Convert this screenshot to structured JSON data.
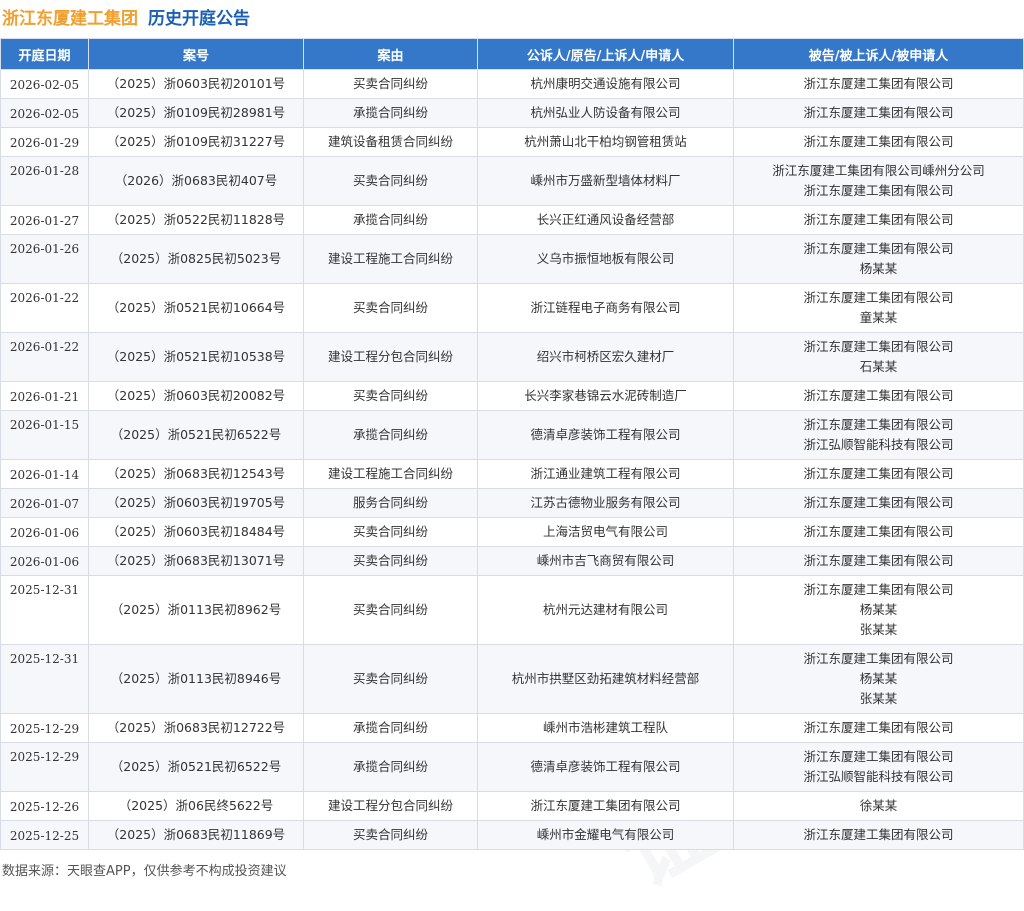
{
  "header": {
    "company": "浙江东厦建工集团",
    "title": "历史开庭公告"
  },
  "table": {
    "columns": [
      "开庭日期",
      "案号",
      "案由",
      "公诉人/原告/上诉人/申请人",
      "被告/被上诉人/被申请人"
    ],
    "rows": [
      {
        "date": "2026-02-05",
        "case": "（2025）浙0603民初20101号",
        "cause": "买卖合同纠纷",
        "plaintiff": "杭州康明交通设施有限公司",
        "defendants": [
          "浙江东厦建工集团有限公司"
        ]
      },
      {
        "date": "2026-02-05",
        "case": "（2025）浙0109民初28981号",
        "cause": "承揽合同纠纷",
        "plaintiff": "杭州弘业人防设备有限公司",
        "defendants": [
          "浙江东厦建工集团有限公司"
        ]
      },
      {
        "date": "2026-01-29",
        "case": "（2025）浙0109民初31227号",
        "cause": "建筑设备租赁合同纠纷",
        "plaintiff": "杭州萧山北干柏均钢管租赁站",
        "defendants": [
          "浙江东厦建工集团有限公司"
        ]
      },
      {
        "date": "2026-01-28",
        "case": "（2026）浙0683民初407号",
        "cause": "买卖合同纠纷",
        "plaintiff": "嵊州市万盛新型墙体材料厂",
        "defendants": [
          "浙江东厦建工集团有限公司嵊州分公司",
          "浙江东厦建工集团有限公司"
        ]
      },
      {
        "date": "2026-01-27",
        "case": "（2025）浙0522民初11828号",
        "cause": "承揽合同纠纷",
        "plaintiff": "长兴正红通风设备经营部",
        "defendants": [
          "浙江东厦建工集团有限公司"
        ]
      },
      {
        "date": "2026-01-26",
        "case": "（2025）浙0825民初5023号",
        "cause": "建设工程施工合同纠纷",
        "plaintiff": "义乌市振恒地板有限公司",
        "defendants": [
          "浙江东厦建工集团有限公司",
          "杨某某"
        ]
      },
      {
        "date": "2026-01-22",
        "case": "（2025）浙0521民初10664号",
        "cause": "买卖合同纠纷",
        "plaintiff": "浙江链程电子商务有限公司",
        "defendants": [
          "浙江东厦建工集团有限公司",
          "童某某"
        ]
      },
      {
        "date": "2026-01-22",
        "case": "（2025）浙0521民初10538号",
        "cause": "建设工程分包合同纠纷",
        "plaintiff": "绍兴市柯桥区宏久建材厂",
        "defendants": [
          "浙江东厦建工集团有限公司",
          "石某某"
        ]
      },
      {
        "date": "2026-01-21",
        "case": "（2025）浙0603民初20082号",
        "cause": "买卖合同纠纷",
        "plaintiff": "长兴李家巷锦云水泥砖制造厂",
        "defendants": [
          "浙江东厦建工集团有限公司"
        ]
      },
      {
        "date": "2026-01-15",
        "case": "（2025）浙0521民初6522号",
        "cause": "承揽合同纠纷",
        "plaintiff": "德清卓彦装饰工程有限公司",
        "defendants": [
          "浙江东厦建工集团有限公司",
          "浙江弘顺智能科技有限公司"
        ]
      },
      {
        "date": "2026-01-14",
        "case": "（2025）浙0683民初12543号",
        "cause": "建设工程施工合同纠纷",
        "plaintiff": "浙江通业建筑工程有限公司",
        "defendants": [
          "浙江东厦建工集团有限公司"
        ]
      },
      {
        "date": "2026-01-07",
        "case": "（2025）浙0603民初19705号",
        "cause": "服务合同纠纷",
        "plaintiff": "江苏古德物业服务有限公司",
        "defendants": [
          "浙江东厦建工集团有限公司"
        ]
      },
      {
        "date": "2026-01-06",
        "case": "（2025）浙0603民初18484号",
        "cause": "买卖合同纠纷",
        "plaintiff": "上海洁贸电气有限公司",
        "defendants": [
          "浙江东厦建工集团有限公司"
        ]
      },
      {
        "date": "2026-01-06",
        "case": "（2025）浙0683民初13071号",
        "cause": "买卖合同纠纷",
        "plaintiff": "嵊州市吉飞商贸有限公司",
        "defendants": [
          "浙江东厦建工集团有限公司"
        ]
      },
      {
        "date": "2025-12-31",
        "case": "（2025）浙0113民初8962号",
        "cause": "买卖合同纠纷",
        "plaintiff": "杭州元达建材有限公司",
        "defendants": [
          "浙江东厦建工集团有限公司",
          "杨某某",
          "张某某"
        ]
      },
      {
        "date": "2025-12-31",
        "case": "（2025）浙0113民初8946号",
        "cause": "买卖合同纠纷",
        "plaintiff": "杭州市拱墅区劲拓建筑材料经营部",
        "defendants": [
          "浙江东厦建工集团有限公司",
          "杨某某",
          "张某某"
        ]
      },
      {
        "date": "2025-12-29",
        "case": "（2025）浙0683民初12722号",
        "cause": "承揽合同纠纷",
        "plaintiff": "嵊州市浩彬建筑工程队",
        "defendants": [
          "浙江东厦建工集团有限公司"
        ]
      },
      {
        "date": "2025-12-29",
        "case": "（2025）浙0521民初6522号",
        "cause": "承揽合同纠纷",
        "plaintiff": "德清卓彦装饰工程有限公司",
        "defendants": [
          "浙江东厦建工集团有限公司",
          "浙江弘顺智能科技有限公司"
        ]
      },
      {
        "date": "2025-12-26",
        "case": "（2025）浙06民终5622号",
        "cause": "建设工程分包合同纠纷",
        "plaintiff": "浙江东厦建工集团有限公司",
        "defendants": [
          "徐某某"
        ]
      },
      {
        "date": "2025-12-25",
        "case": "（2025）浙0683民初11869号",
        "cause": "买卖合同纠纷",
        "plaintiff": "嵊州市金耀电气有限公司",
        "defendants": [
          "浙江东厦建工集团有限公司"
        ]
      }
    ]
  },
  "footer": {
    "source": "数据来源：天眼查APP，仅供参考不构成投资建议"
  },
  "watermark": {
    "text": "证券之星"
  },
  "colors": {
    "company": "#f0a030",
    "title": "#1a5fb4",
    "header_bg": "#3578c9"
  }
}
